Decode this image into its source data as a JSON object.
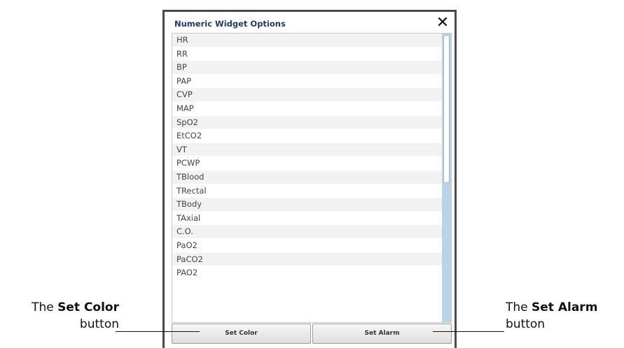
{
  "dialog": {
    "title": "Numeric Widget Options",
    "close_glyph": "✕",
    "items": [
      "HR",
      "RR",
      "BP",
      "PAP",
      "CVP",
      "MAP",
      "SpO2",
      "EtCO2",
      "VT",
      "PCWP",
      "TBlood",
      "TRectal",
      "TBody",
      "TAxial",
      "C.O.",
      "PaO2",
      "PaCO2",
      "PAO2"
    ],
    "buttons": {
      "set_color": "Set Color",
      "set_alarm": "Set Alarm"
    }
  },
  "callouts": {
    "left": {
      "prefix": "The ",
      "bold": "Set Color",
      "suffix": "button"
    },
    "right": {
      "prefix": "The ",
      "bold": "Set Alarm",
      "suffix": "button"
    }
  },
  "colors": {
    "title": "#1f3b63",
    "scrollbar_track": "#b9d3e8",
    "row_alt": "#f2f2f2"
  }
}
